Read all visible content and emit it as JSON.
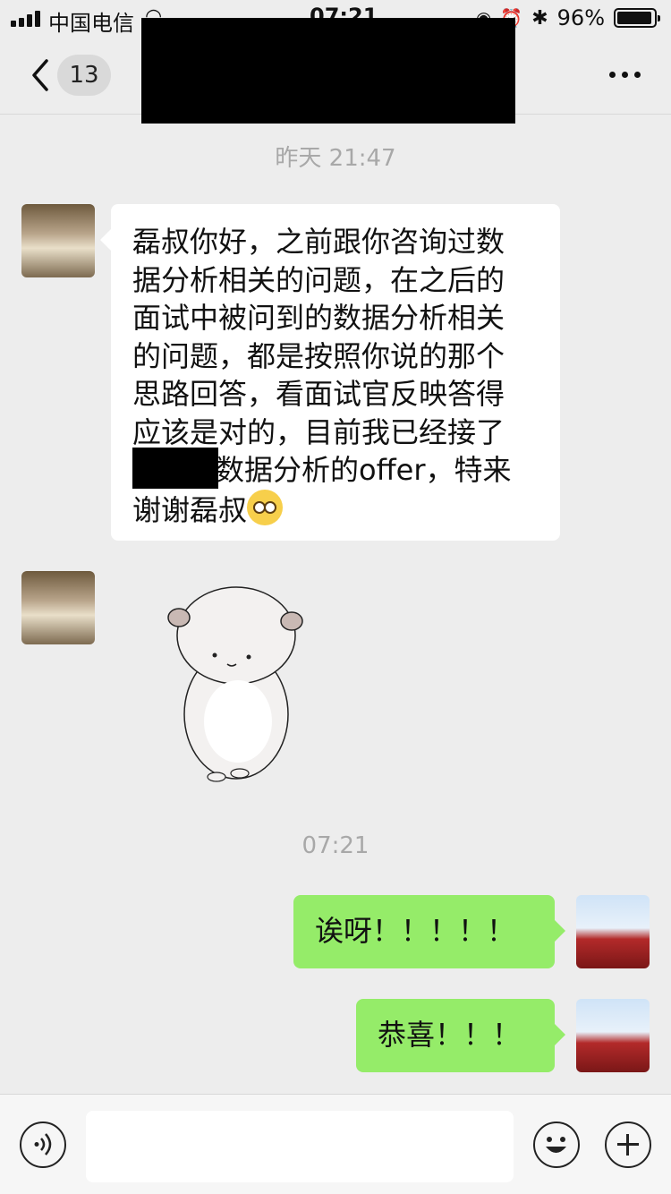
{
  "status_bar": {
    "carrier": "中国电信",
    "time": "07:21",
    "battery_percent": "96%",
    "battery_level": 0.96,
    "icons": [
      "signal-icon",
      "wifi-icon",
      "location-icon",
      "alarm-icon",
      "bluetooth-icon",
      "battery-icon"
    ]
  },
  "nav": {
    "unread_count": "13",
    "title": "",
    "icons": [
      "back-icon",
      "more-icon"
    ]
  },
  "chat": {
    "timestamps": [
      "昨天 21:47",
      "07:21"
    ],
    "messages": [
      {
        "direction": "in",
        "type": "text",
        "text": "磊叔你好，之前跟你咨询过数\n据分析相关的问题，在之后的\n面试中被问到的数据分析相关\n的问题，都是按照你说的那个\n思路回答，看面试官反映答得\n应该是对的，目前我已经接了\n      的数据分析的offer，特来\n谢谢磊叔",
        "emoji": "thinking-face-emoji"
      },
      {
        "direction": "in",
        "type": "sticker",
        "sticker": "hamster-sticker"
      },
      {
        "direction": "out",
        "type": "text",
        "text": "诶呀！！！！！"
      },
      {
        "direction": "out",
        "type": "text",
        "text": "恭喜！！！"
      }
    ]
  },
  "input_bar": {
    "placeholder": "",
    "icons": [
      "voice-icon",
      "emoji-icon",
      "plus-icon"
    ]
  },
  "colors": {
    "background": "#ededed",
    "incoming_bubble": "#ffffff",
    "outgoing_bubble": "#95ec69",
    "timestamp": "#a8a8a8"
  }
}
